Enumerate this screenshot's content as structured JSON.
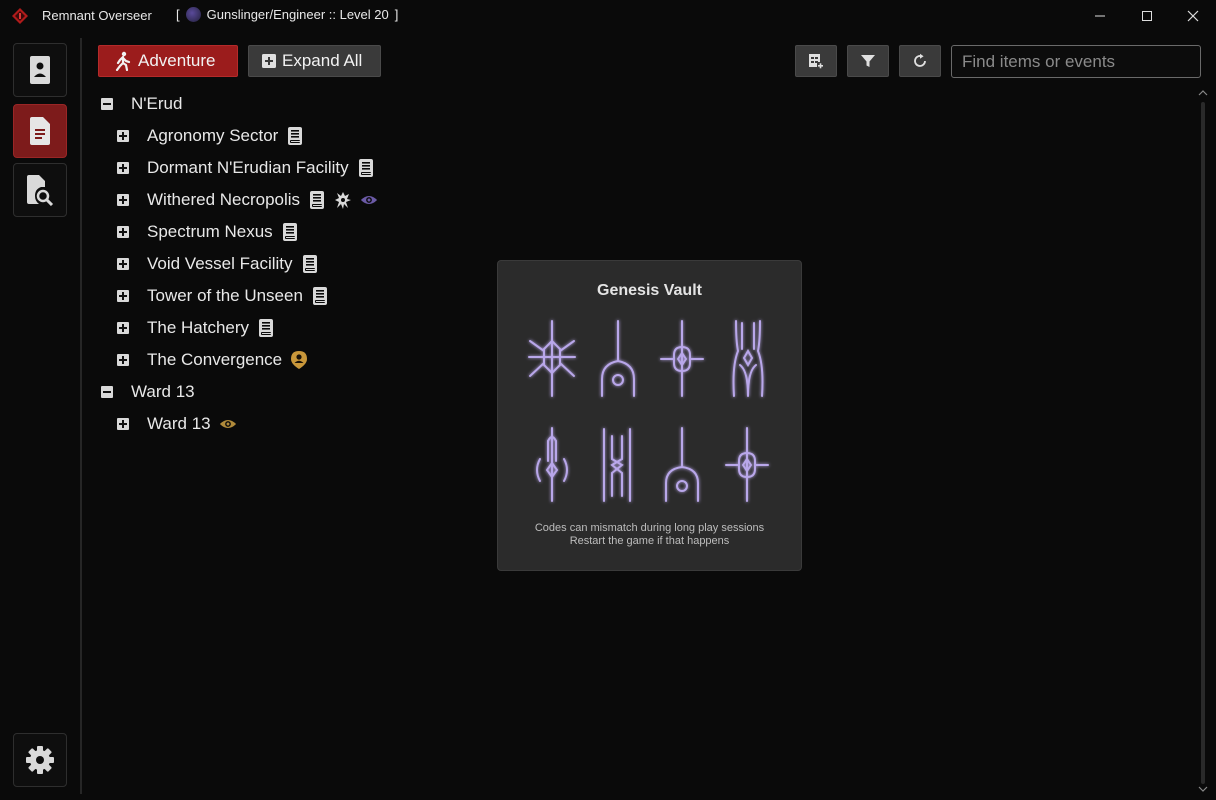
{
  "titlebar": {
    "app_title": "Remnant Overseer",
    "bracket_open": "[",
    "character": "Gunslinger/Engineer :: Level 20",
    "bracket_close": "]"
  },
  "toolbar": {
    "adventure_label": "Adventure",
    "expand_label": "Expand All",
    "search_placeholder": "Find items or events"
  },
  "tree": [
    {
      "label": "N'Erud",
      "level": 0,
      "toggle": "minus",
      "icons": []
    },
    {
      "label": "Agronomy Sector",
      "level": 1,
      "toggle": "plus",
      "icons": [
        "book-icon"
      ]
    },
    {
      "label": "Dormant N'Erudian Facility",
      "level": 1,
      "toggle": "plus",
      "icons": [
        "book-icon"
      ]
    },
    {
      "label": "Withered Necropolis",
      "level": 1,
      "toggle": "plus",
      "icons": [
        "book-icon",
        "boss-icon",
        "eye-icon"
      ]
    },
    {
      "label": "Spectrum Nexus",
      "level": 1,
      "toggle": "plus",
      "icons": [
        "book-icon"
      ]
    },
    {
      "label": "Void Vessel Facility",
      "level": 1,
      "toggle": "plus",
      "icons": [
        "book-icon"
      ]
    },
    {
      "label": "Tower of the Unseen",
      "level": 1,
      "toggle": "plus",
      "icons": [
        "book-icon"
      ]
    },
    {
      "label": "The Hatchery",
      "level": 1,
      "toggle": "plus",
      "icons": [
        "book-icon"
      ]
    },
    {
      "label": "The Convergence",
      "level": 1,
      "toggle": "plus",
      "icons": [
        "person-icon"
      ]
    },
    {
      "label": "Ward 13",
      "level": 0,
      "toggle": "minus",
      "icons": []
    },
    {
      "label": "Ward 13",
      "level": 1,
      "toggle": "plus",
      "icons": [
        "eye-icon"
      ]
    }
  ],
  "popup": {
    "title": "Genesis Vault",
    "note_line1": "Codes can mismatch during long play sessions",
    "note_line2": "Restart the game if that happens"
  },
  "colors": {
    "accent_red": "#9b1c1c",
    "glyph_purple": "#b9a7ea",
    "eye_purple": "#6b5aa6",
    "eye_gold": "#b08a3a",
    "person_gold": "#c9973a"
  }
}
